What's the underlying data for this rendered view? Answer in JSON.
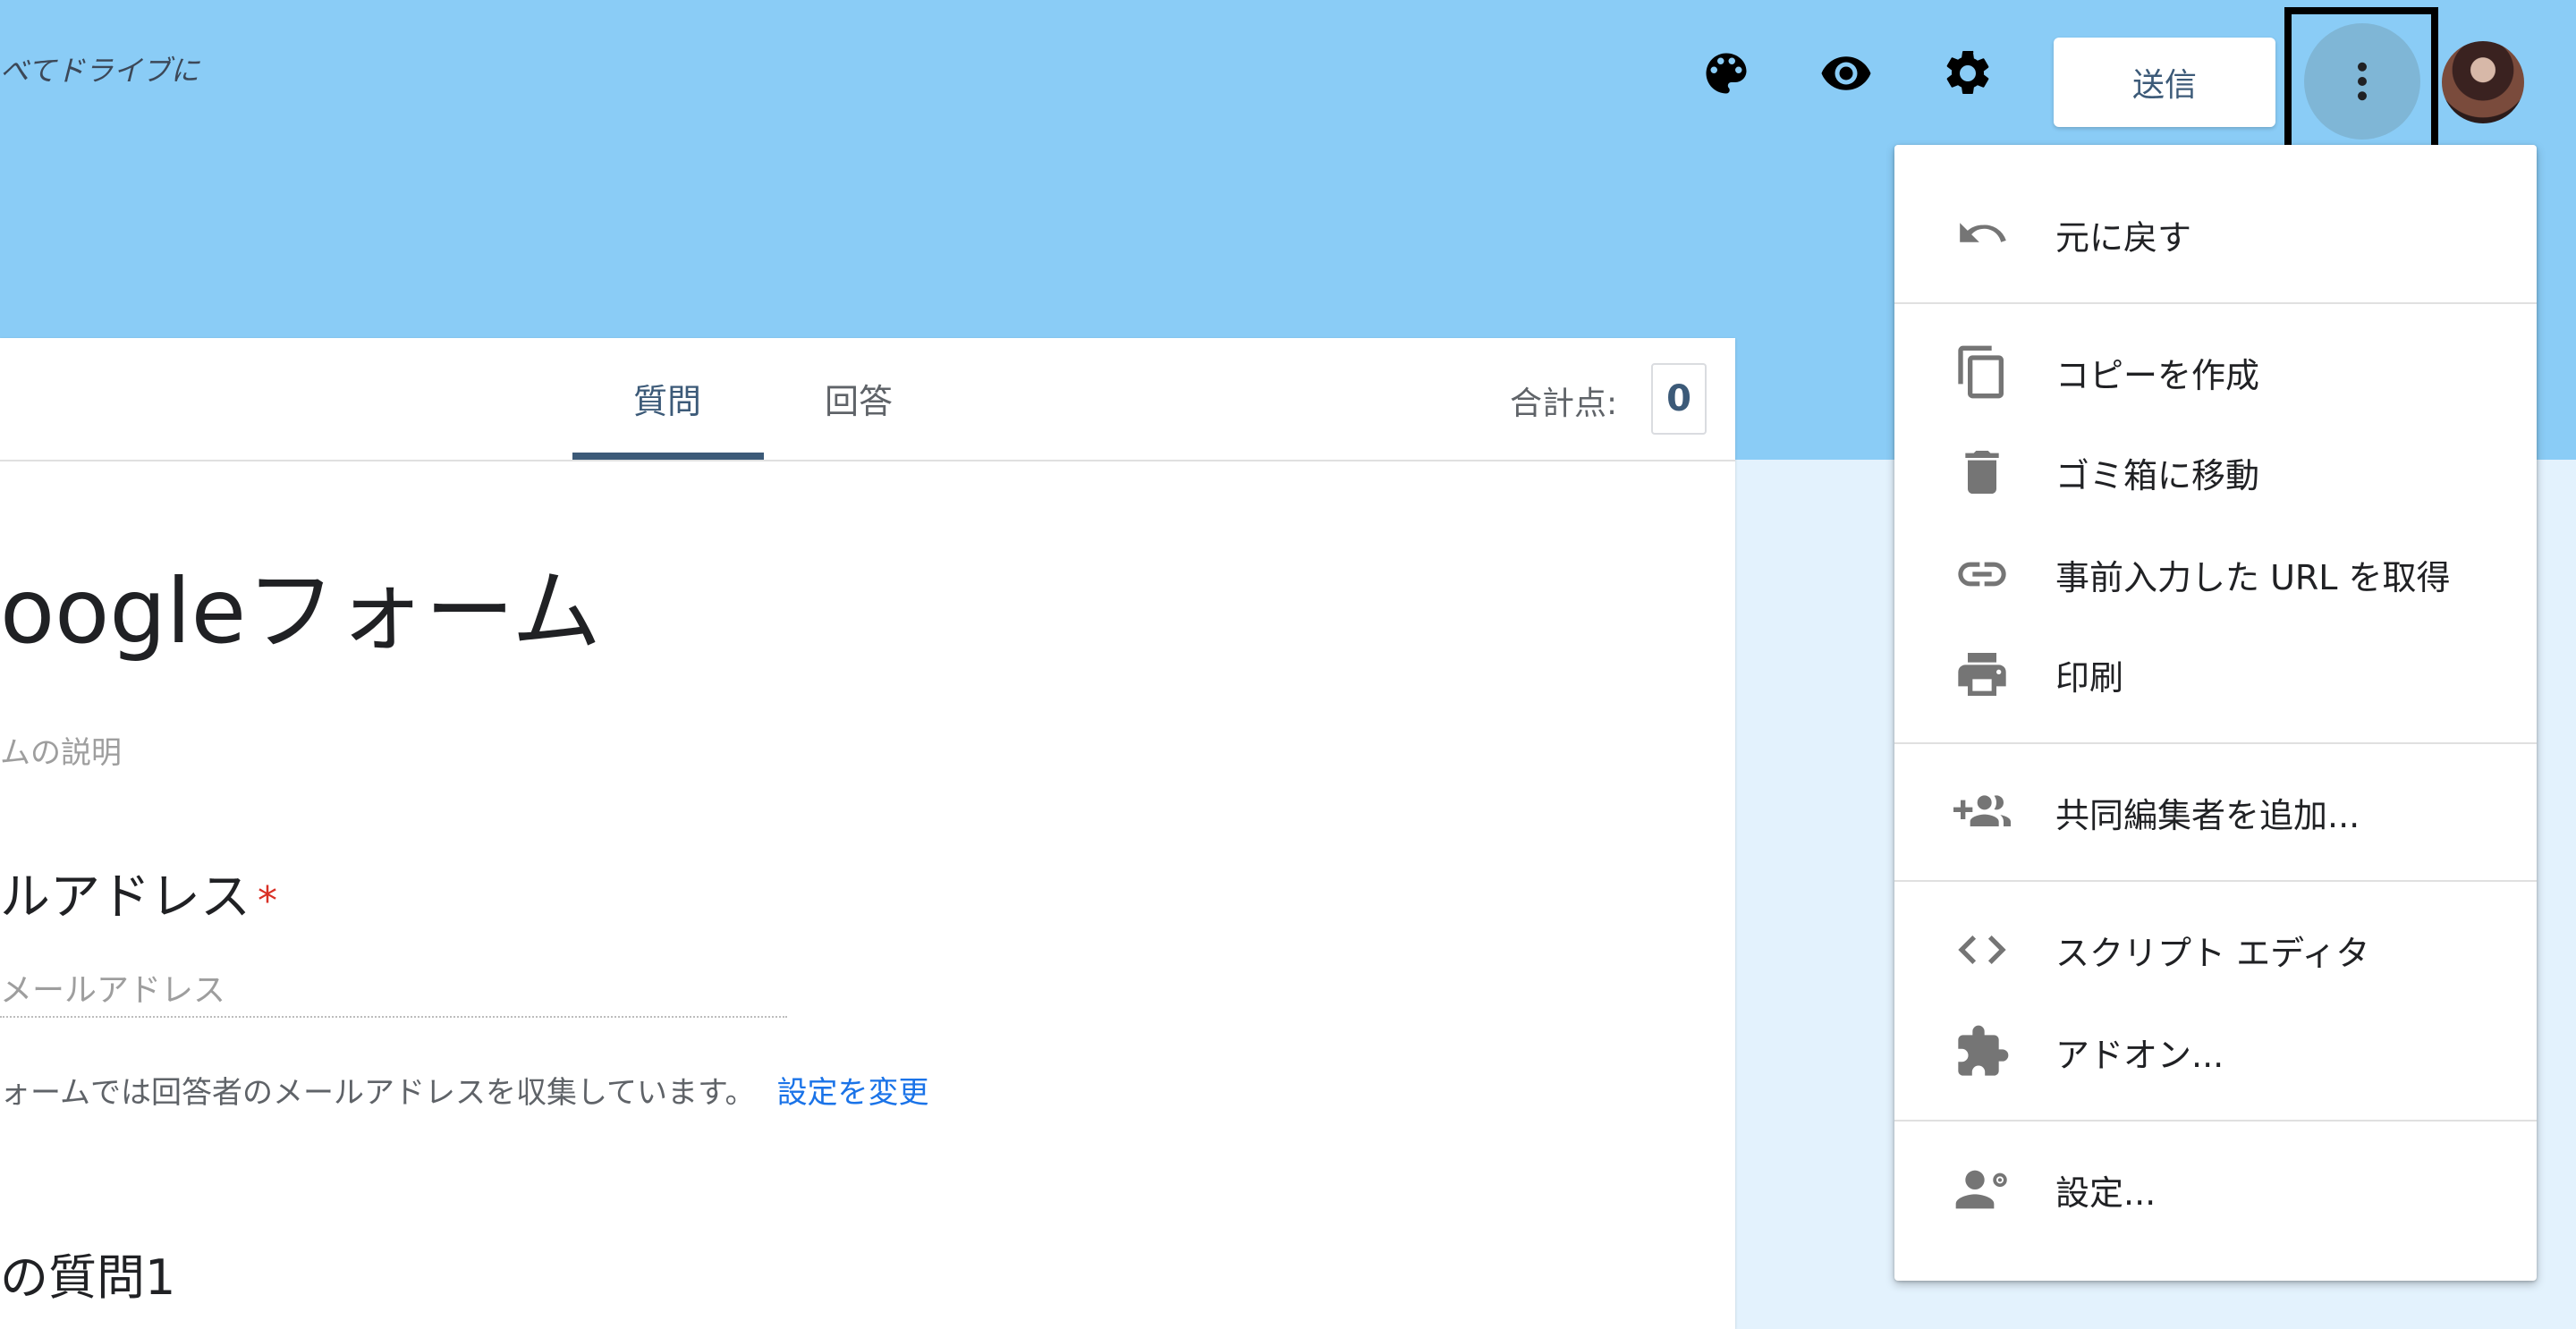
{
  "header": {
    "saved_text": "べてドライブに",
    "send_label": "送信",
    "icons": [
      "palette-icon",
      "eye-icon",
      "gear-icon",
      "more-vert-icon"
    ]
  },
  "tabs": {
    "questions": "質問",
    "answers": "回答",
    "total_label": "合計点:",
    "total_value": "0"
  },
  "form": {
    "title": "oogleフォーム",
    "description": "ムの説明",
    "email_question": "ルアドレス",
    "required_mark": "*",
    "email_placeholder": "メールアドレス",
    "collect_note": "ォームでは回答者のメールアドレスを収集しています。",
    "change_settings_link": "設定を変更",
    "untitled_question": "の質問1"
  },
  "menu": {
    "items": [
      {
        "label": "元に戻す",
        "icon": "undo-icon"
      },
      {
        "label": "コピーを作成",
        "icon": "copy-icon"
      },
      {
        "label": "ゴミ箱に移動",
        "icon": "trash-icon"
      },
      {
        "label": "事前入力した URL を取得",
        "icon": "link-icon"
      },
      {
        "label": "印刷",
        "icon": "print-icon"
      },
      {
        "label": "共同編集者を追加...",
        "icon": "add-people-icon"
      },
      {
        "label": "スクリプト エディタ",
        "icon": "code-icon"
      },
      {
        "label": "アドオン...",
        "icon": "puzzle-icon"
      },
      {
        "label": "設定...",
        "icon": "person-gear-icon"
      }
    ]
  },
  "colors": {
    "header_bg": "#8accf6",
    "page_bg": "#e3f2fd",
    "accent": "#3c5a78",
    "link": "#1a73e8",
    "required": "#d93025"
  }
}
